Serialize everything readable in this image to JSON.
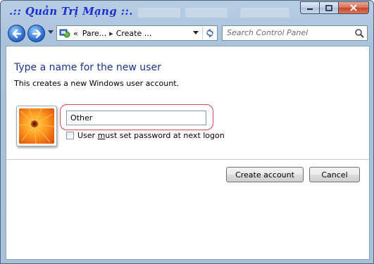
{
  "titlebar": {
    "title": ".:: Quản Trị Mạng ::.",
    "buttons": {
      "minimize": "—",
      "maximize": "□",
      "close": "✕"
    }
  },
  "navigation": {
    "back_icon": "back-arrow-icon",
    "forward_icon": "forward-arrow-icon",
    "breadcrumb": {
      "overflow": "«",
      "items": [
        "Pare...",
        "Create ..."
      ]
    },
    "search_placeholder": "Search Control Panel"
  },
  "content": {
    "heading": "Type a name for the new user",
    "description": "This creates a new Windows user account.",
    "name_value": "Other",
    "checkbox": {
      "before": "User ",
      "mnemonic": "m",
      "after": "ust set password at next logon",
      "checked": false
    },
    "create_button": "Create account",
    "cancel_button": "Cancel"
  },
  "colors": {
    "heading": "#1e3287",
    "title": "#1a2fd1",
    "highlight_ring": "#d3454f"
  }
}
